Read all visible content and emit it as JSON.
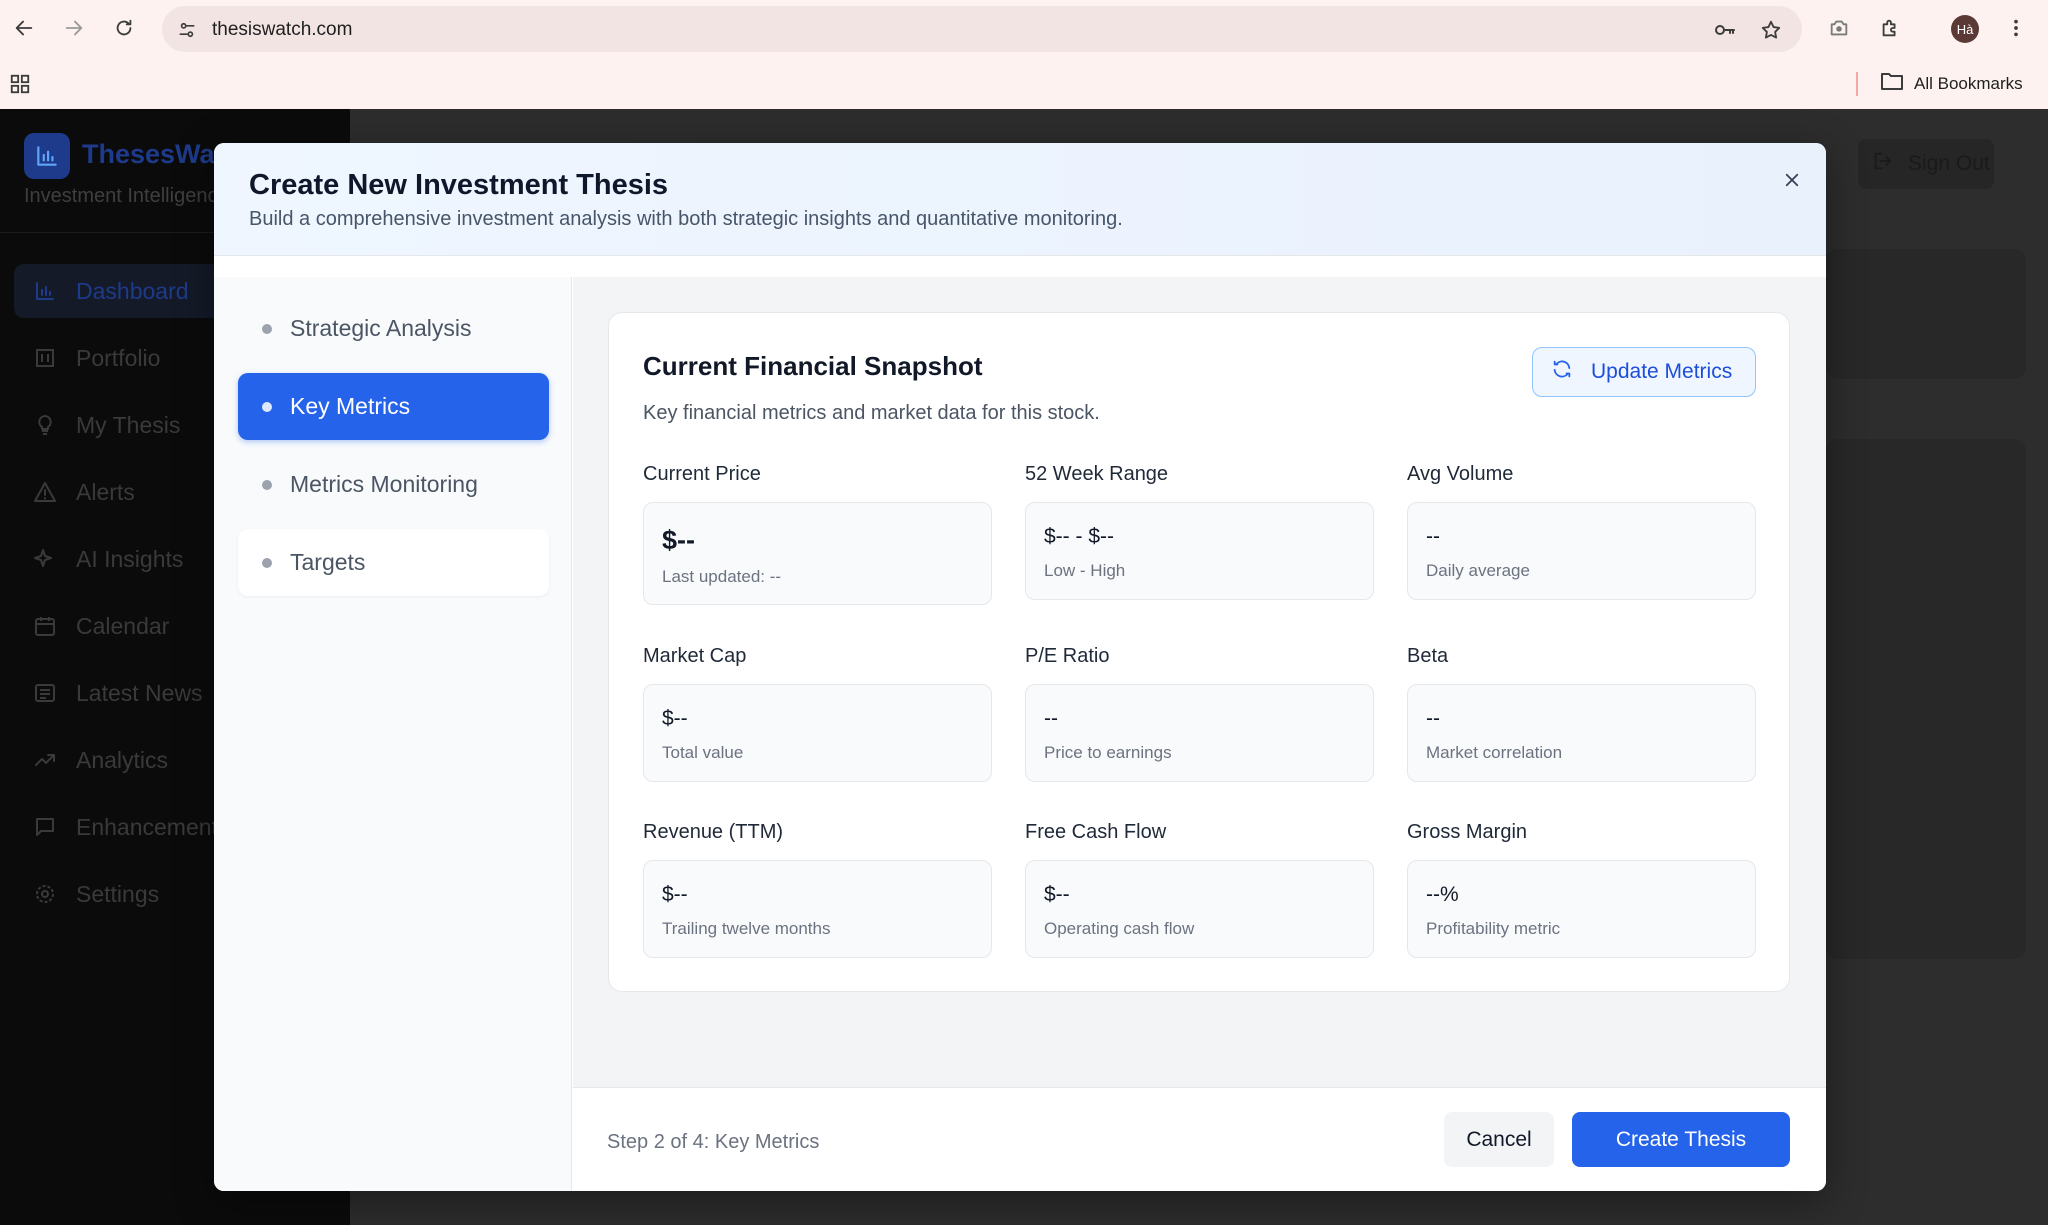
{
  "browser": {
    "url": "thesiswatch.com",
    "avatar_initials": "Hà",
    "bookmarks_label": "All Bookmarks",
    "icons": [
      "back-icon",
      "forward-icon",
      "reload-icon",
      "site-info-icon",
      "password-key-icon",
      "bookmark-star-icon",
      "screenshot-icon",
      "extensions-icon",
      "menu-dots-icon",
      "apps-grid-icon",
      "folder-icon"
    ]
  },
  "app": {
    "brand": "ThesesWatch",
    "tagline": "Investment Intelligence",
    "sign_out": "Sign Out",
    "nav": [
      {
        "label": "Dashboard",
        "icon": "bar-chart-icon"
      },
      {
        "label": "Portfolio",
        "icon": "building-icon"
      },
      {
        "label": "My Thesis",
        "icon": "lightbulb-icon"
      },
      {
        "label": "Alerts",
        "icon": "warning-icon"
      },
      {
        "label": "AI Insights",
        "icon": "sparkle-icon"
      },
      {
        "label": "Calendar",
        "icon": "calendar-icon"
      },
      {
        "label": "Latest News",
        "icon": "newspaper-icon"
      },
      {
        "label": "Analytics",
        "icon": "trend-icon"
      },
      {
        "label": "Enhancements",
        "icon": "message-icon"
      },
      {
        "label": "Settings",
        "icon": "gear-icon"
      }
    ]
  },
  "modal": {
    "title": "Create New Investment Thesis",
    "subtitle": "Build a comprehensive investment analysis with both strategic insights and quantitative monitoring.",
    "steps": [
      {
        "label": "Strategic Analysis"
      },
      {
        "label": "Key Metrics"
      },
      {
        "label": "Metrics Monitoring"
      },
      {
        "label": "Targets"
      }
    ],
    "active_step": "Key Metrics",
    "card": {
      "title": "Current Financial Snapshot",
      "subtitle": "Key financial metrics and market data for this stock.",
      "update_label": "Update Metrics",
      "metrics": [
        {
          "label": "Current Price",
          "value": "$--",
          "note": "Last updated: --"
        },
        {
          "label": "52 Week Range",
          "value": "$-- - $--",
          "note": "Low - High"
        },
        {
          "label": "Avg Volume",
          "value": "--",
          "note": "Daily average"
        },
        {
          "label": "Market Cap",
          "value": "$--",
          "note": "Total value"
        },
        {
          "label": "P/E Ratio",
          "value": "--",
          "note": "Price to earnings"
        },
        {
          "label": "Beta",
          "value": "--",
          "note": "Market correlation"
        },
        {
          "label": "Revenue (TTM)",
          "value": "$--",
          "note": "Trailing twelve months"
        },
        {
          "label": "Free Cash Flow",
          "value": "$--",
          "note": "Operating cash flow"
        },
        {
          "label": "Gross Margin",
          "value": "--%",
          "note": "Profitability metric"
        }
      ]
    },
    "footer": {
      "step_text": "Step 2 of 4: Key Metrics",
      "cancel": "Cancel",
      "create": "Create Thesis"
    }
  },
  "colors": {
    "primary": "#2563eb",
    "header_bg": "#eff6ff",
    "sidebar_bg": "#0b0b0b"
  }
}
